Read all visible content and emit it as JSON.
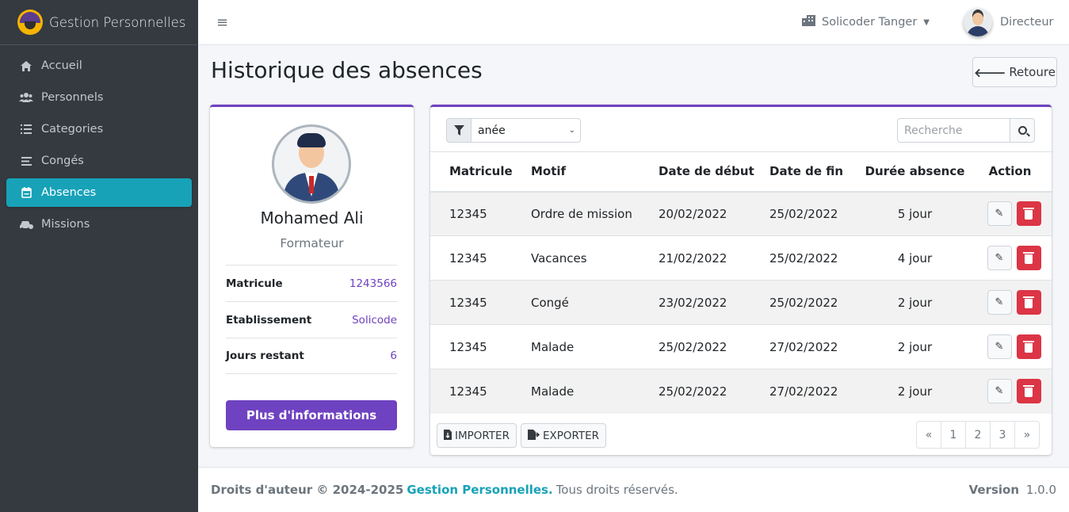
{
  "brand": {
    "name": "Gestion Personnelles"
  },
  "sidebar": {
    "items": [
      {
        "label": "Accueil",
        "icon": "home-icon"
      },
      {
        "label": "Personnels",
        "icon": "users-icon"
      },
      {
        "label": "Categories",
        "icon": "list-icon"
      },
      {
        "label": "Congés",
        "icon": "bars-icon"
      },
      {
        "label": "Absences",
        "icon": "calendar-icon",
        "active": true
      },
      {
        "label": "Missions",
        "icon": "car-icon"
      }
    ]
  },
  "topbar": {
    "company": "Solicoder Tanger",
    "user": "Directeur"
  },
  "page": {
    "title": "Historique des absences",
    "back_label": "Retoure"
  },
  "profile": {
    "name": "Mohamed Ali",
    "role": "Formateur",
    "info": [
      {
        "label": "Matricule",
        "value": "1243566"
      },
      {
        "label": "Etablissement",
        "value": "Solicode"
      },
      {
        "label": "Jours restant",
        "value": "6"
      }
    ],
    "more_label": "Plus d'informations"
  },
  "filters": {
    "year_select": "anée",
    "search_placeholder": "Recherche"
  },
  "table": {
    "headers": [
      "Matricule",
      "Motif",
      "Date de début",
      "Date de fin",
      "Durée absence",
      "Action"
    ],
    "rows": [
      [
        "12345",
        "Ordre de mission",
        "20/02/2022",
        "25/02/2022",
        "5 jour"
      ],
      [
        "12345",
        "Vacances",
        "21/02/2022",
        "25/02/2022",
        "4 jour"
      ],
      [
        "12345",
        "Congé",
        "23/02/2022",
        "25/02/2022",
        "2 jour"
      ],
      [
        "12345",
        "Malade",
        "25/02/2022",
        "27/02/2022",
        "2 jour"
      ],
      [
        "12345",
        "Malade",
        "25/02/2022",
        "27/02/2022",
        "2 jour"
      ]
    ]
  },
  "table_footer": {
    "import_label": "IMPORTER",
    "export_label": "EXPORTER",
    "pages": [
      "«",
      "1",
      "2",
      "3",
      "»"
    ]
  },
  "footer": {
    "copyright": "Droits d'auteur © 2024-2025",
    "brand": "Gestion Personnelles.",
    "rights": "Tous droits réservés.",
    "version_label": "Version",
    "version": "1.0.0"
  },
  "colors": {
    "accent": "#6f42c1",
    "active": "#17a2b8",
    "danger": "#dc3545",
    "sidebar": "#343a40"
  }
}
